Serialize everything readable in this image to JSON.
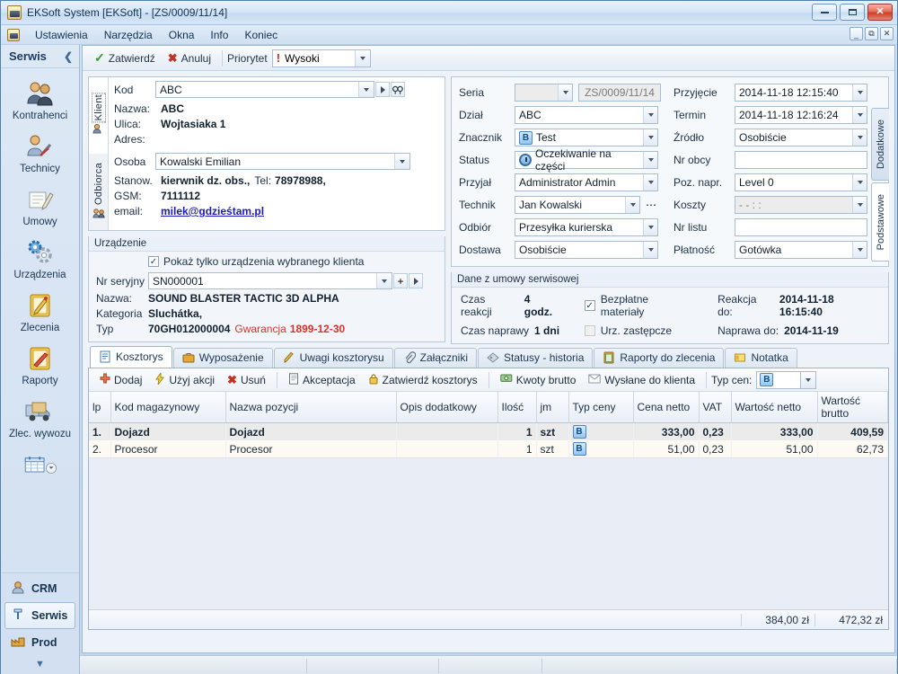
{
  "window": {
    "title": "EKSoft System [EKSoft] - [ZS/0009/11/14]",
    "minimize": "–",
    "maximize": "❐",
    "close": "✕"
  },
  "menu": {
    "items": [
      {
        "label": "Ustawienia"
      },
      {
        "label": "Narzędzia"
      },
      {
        "label": "Okna"
      },
      {
        "label": "Info"
      },
      {
        "label": "Koniec"
      }
    ],
    "mdi": {
      "minimize": "–",
      "restore": "❐",
      "close": "✕"
    }
  },
  "sidebar": {
    "title": "Serwis",
    "collapse": "❮",
    "items": [
      {
        "label": "Kontrahenci",
        "icon": "users-icon"
      },
      {
        "label": "Technicy",
        "icon": "technician-icon"
      },
      {
        "label": "Umowy",
        "icon": "contract-icon"
      },
      {
        "label": "Urządzenia",
        "icon": "gears-icon"
      },
      {
        "label": "Zlecenia",
        "icon": "clipboard-pencil-icon"
      },
      {
        "label": "Raporty",
        "icon": "clipboard-report-icon"
      },
      {
        "label": "Zlec. wywozu",
        "icon": "truck-icon"
      }
    ],
    "calendar_icon": "calendar-icon",
    "groups": [
      {
        "label": "CRM",
        "icon": "crm-icon",
        "selected": false
      },
      {
        "label": "Serwis",
        "icon": "serwis-icon",
        "selected": true
      },
      {
        "label": "Prod",
        "icon": "factory-icon",
        "selected": false
      }
    ],
    "more": "▼"
  },
  "toolbar": {
    "confirm": "Zatwierdź",
    "cancel": "Anuluj",
    "priority_label": "Priorytet",
    "priority_value": "Wysoki"
  },
  "client_panel": {
    "vtabs": [
      {
        "label": "Klient",
        "active": true
      },
      {
        "label": "Odbiorca",
        "active": false
      }
    ],
    "kod_label": "Kod",
    "kod_value": "ABC",
    "fields": [
      {
        "label": "Nazwa:",
        "value": "ABC"
      },
      {
        "label": "Ulica:",
        "value": "Wojtasiaka 1"
      },
      {
        "label": "Adres:",
        "value": ""
      }
    ],
    "osoba_label": "Osoba",
    "osoba_value": "Kowalski Emilian",
    "stanow_label": "Stanow.",
    "stanow_value": "kierwnik dz. obs.,",
    "tel_label": "Tel:",
    "tel_value": "78978988,",
    "gsm_label": "GSM:",
    "gsm_value": "7111112",
    "email_label": "email:",
    "email_value": "milek@gdzieśtam.pl"
  },
  "device_panel": {
    "title": "Urządzenie",
    "checkbox_label": "Pokaż tylko urządzenia wybranego klienta",
    "checkbox_checked": true,
    "serial_label": "Nr seryjny",
    "serial_value": "SN000001",
    "rows": [
      {
        "label": "Nazwa:",
        "value": "SOUND BLASTER TACTIC 3D ALPHA"
      },
      {
        "label": "Kategoria",
        "value": "Sluchátka,"
      },
      {
        "label": "Typ",
        "value": "70GH012000004"
      }
    ],
    "warranty_label": "Gwarancja",
    "warranty_value": "1899-12-30"
  },
  "order_form": {
    "left": [
      {
        "label": "Seria",
        "value": "",
        "value2": "ZS/0009/11/14",
        "type": "series"
      },
      {
        "label": "Dział",
        "value": "ABC",
        "type": "combo"
      },
      {
        "label": "Znacznik",
        "value": "Test",
        "type": "combo-badge",
        "badge": "B"
      },
      {
        "label": "Status",
        "value": "Oczekiwanie na części",
        "type": "combo-clock"
      },
      {
        "label": "Przyjał",
        "value": "Administrator Admin",
        "type": "combo"
      },
      {
        "label": "Technik",
        "value": "Jan Kowalski",
        "type": "combo-dots"
      },
      {
        "label": "Odbiór",
        "value": "Przesyłka kurierska",
        "type": "combo"
      },
      {
        "label": "Dostawa",
        "value": "Osobiście",
        "type": "combo"
      }
    ],
    "right": [
      {
        "label": "Przyjęcie",
        "value": "2014-11-18 12:15:40",
        "type": "combo"
      },
      {
        "label": "Termin",
        "value": "2014-11-18 12:16:24",
        "type": "combo"
      },
      {
        "label": "Źródło",
        "value": "Osobiście",
        "type": "combo"
      },
      {
        "label": "Nr obcy",
        "value": "",
        "type": "text"
      },
      {
        "label": "Poz. napr.",
        "value": "Level 0",
        "type": "combo"
      },
      {
        "label": "Koszty",
        "value": "  -  -      :  :",
        "type": "combo-disabled"
      },
      {
        "label": "Nr listu",
        "value": "",
        "type": "text"
      },
      {
        "label": "Płatność",
        "value": "Gotówka",
        "type": "combo"
      }
    ],
    "vtabs": [
      {
        "label": "Dodatkowe",
        "active": false
      },
      {
        "label": "Podstawowe",
        "active": true
      }
    ]
  },
  "contract_panel": {
    "title": "Dane z umowy serwisowej",
    "reaction_time_label": "Czas reakcji",
    "reaction_time_value": "4 godz.",
    "repair_time_label": "Czas naprawy",
    "repair_time_value": "1 dni",
    "free_materials_label": "Bezpłatne materiały",
    "free_materials_checked": true,
    "replacement_label": "Urz. zastępcze",
    "replacement_checked": false,
    "reaction_due_label": "Reakcja do:",
    "reaction_due_value": "2014-11-18 16:15:40",
    "repair_due_label": "Naprawa do:",
    "repair_due_value": "2014-11-19"
  },
  "tabs": [
    {
      "label": "Kosztorys",
      "icon": "estimate-icon",
      "active": true
    },
    {
      "label": "Wyposażenie",
      "icon": "briefcase-icon",
      "active": false
    },
    {
      "label": "Uwagi kosztorysu",
      "icon": "pencil-icon",
      "active": false
    },
    {
      "label": "Załączniki",
      "icon": "paperclip-icon",
      "active": false
    },
    {
      "label": "Statusy - historia",
      "icon": "tag-icon",
      "active": false
    },
    {
      "label": "Raporty do zlecenia",
      "icon": "clipboard-icon",
      "active": false
    },
    {
      "label": "Notatka",
      "icon": "note-icon",
      "active": false
    }
  ],
  "grid_toolbar": {
    "add": "Dodaj",
    "use_action": "Użyj akcji",
    "delete": "Usuń",
    "acceptance": "Akceptacja",
    "approve_estimate": "Zatwierdź kosztorys",
    "gross_amounts": "Kwoty brutto",
    "sent_to_client": "Wysłane do klienta",
    "price_type_label": "Typ cen:",
    "price_type_value": "B"
  },
  "grid": {
    "columns": [
      "lp",
      "Kod magazynowy",
      "Nazwa pozycji",
      "Opis dodatkowy",
      "Ilość",
      "jm",
      "Typ ceny",
      "Cena netto",
      "VAT",
      "Wartość netto",
      "Wartość brutto"
    ],
    "rows": [
      {
        "lp": "1.",
        "kod": "Dojazd",
        "nazwa": "Dojazd",
        "opis": "",
        "ilosc": "1",
        "jm": "szt",
        "typ": "B",
        "cena_netto": "333,00",
        "vat": "0,23",
        "wartosc_netto": "333,00",
        "wartosc_brutto": "409,59",
        "selected": true
      },
      {
        "lp": "2.",
        "kod": "Procesor",
        "nazwa": "Procesor",
        "opis": "",
        "ilosc": "1",
        "jm": "szt",
        "typ": "B",
        "cena_netto": "51,00",
        "vat": "0,23",
        "wartosc_netto": "51,00",
        "wartosc_brutto": "62,73",
        "selected": false
      }
    ],
    "totals": {
      "net": "384,00 zł",
      "gross": "472,32 zł"
    }
  }
}
